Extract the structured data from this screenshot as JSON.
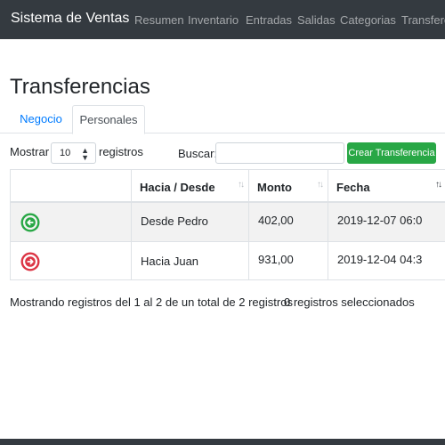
{
  "navbar": {
    "brand": "Sistema de Ventas",
    "links": [
      "Resumen",
      "Inventario",
      "Entradas",
      "Salidas",
      "Categorias",
      "Transferencias"
    ]
  },
  "page": {
    "title": "Transferencias"
  },
  "tabs": [
    {
      "label": "Negocio",
      "active": false
    },
    {
      "label": "Personales",
      "active": true
    }
  ],
  "controls": {
    "show_label": "Mostrar",
    "page_length": "10",
    "records_label": "registros",
    "search_label": "Buscar:",
    "search_value": "",
    "create_button": "Crear Transferencia"
  },
  "table": {
    "columns": [
      "",
      "Hacia / Desde",
      "Monto",
      "Fecha"
    ],
    "sorted_column": "Fecha",
    "rows": [
      {
        "direction_icon": "arrow-left-circle-icon",
        "direction_color": "#28a745",
        "party": "Desde Pedro",
        "amount": "402,00",
        "date": "2019-12-07 06:0"
      },
      {
        "direction_icon": "arrow-right-circle-icon",
        "direction_color": "#dc3545",
        "party": "Hacia Juan",
        "amount": "931,00",
        "date": "2019-12-04 04:3"
      }
    ]
  },
  "footer": {
    "info": "Mostrando registros del 1 al 2 de un total de 2 registros",
    "selected": "0 registros seleccionados"
  },
  "colors": {
    "navbar_bg": "#343a40",
    "accent": "#007bff",
    "success": "#28a745",
    "danger": "#dc3545"
  }
}
